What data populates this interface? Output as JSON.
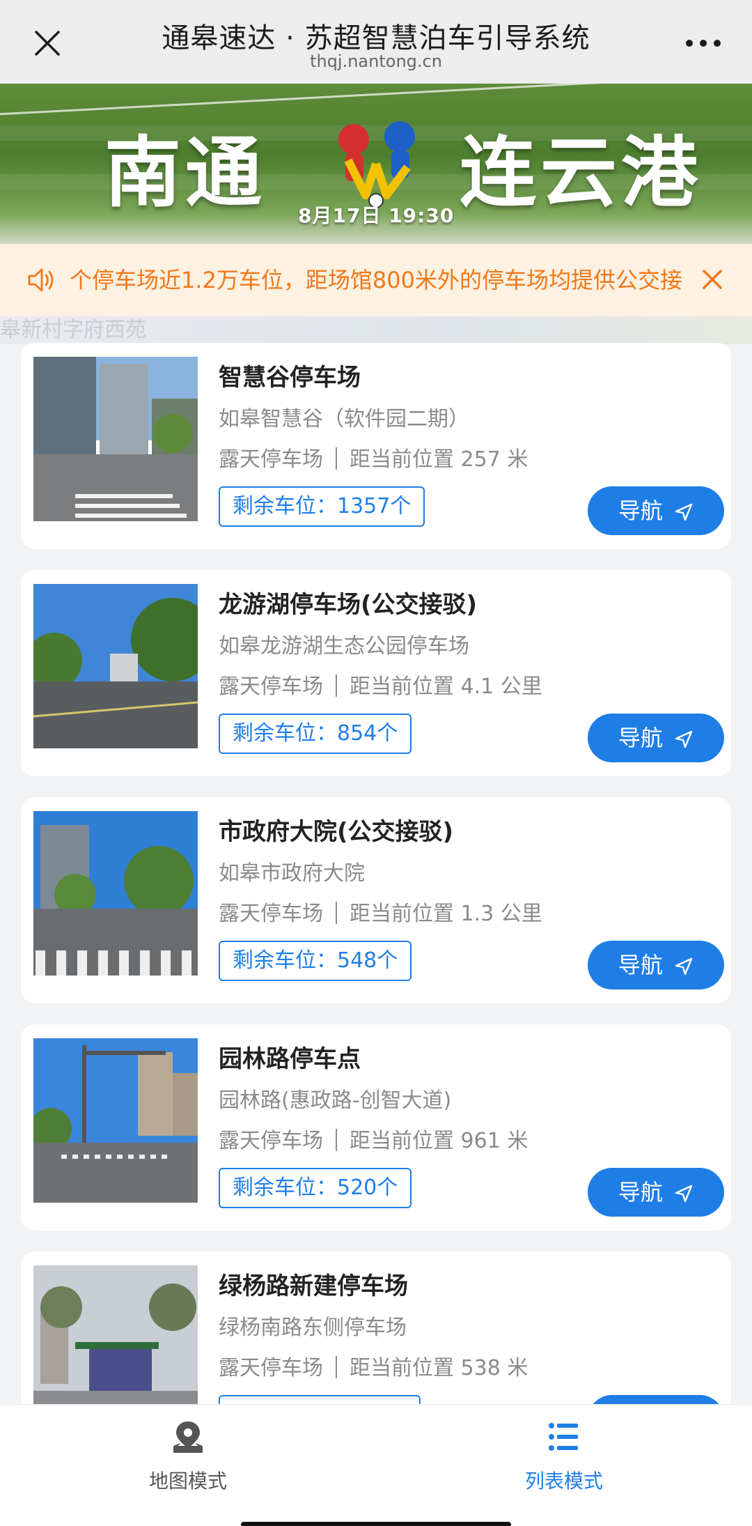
{
  "header": {
    "title": "通皋速达 · 苏超智慧泊车引导系统",
    "url": "thqj.nantong.cn"
  },
  "banner": {
    "team_left": "南通",
    "team_right": "连云港",
    "datetime": "8月17日  19:30"
  },
  "notice": {
    "text": "个停车场近1.2万车位，距场馆800米外的停车场均提供公交接"
  },
  "map_peek_text": "皋新村字府西苑",
  "lots": [
    {
      "name": "智慧谷停车场",
      "address": "如皋智慧谷（软件园二期）",
      "type": "露天停车场",
      "distance": "距当前位置 257 米",
      "spaces": "剩余车位：1357个",
      "nav_label": "导航"
    },
    {
      "name": "龙游湖停车场(公交接驳)",
      "address": "如皋龙游湖生态公园停车场",
      "type": "露天停车场",
      "distance": "距当前位置 4.1 公里",
      "spaces": "剩余车位：854个",
      "nav_label": "导航"
    },
    {
      "name": "市政府大院(公交接驳)",
      "address": "如皋市政府大院",
      "type": "露天停车场",
      "distance": "距当前位置 1.3 公里",
      "spaces": "剩余车位：548个",
      "nav_label": "导航"
    },
    {
      "name": "园林路停车点",
      "address": "园林路(惠政路-创智大道)",
      "type": "露天停车场",
      "distance": "距当前位置 961 米",
      "spaces": "剩余车位：520个",
      "nav_label": "导航"
    },
    {
      "name": "绿杨路新建停车场",
      "address": "绿杨南路东侧停车场",
      "type": "露天停车场",
      "distance": "距当前位置 538 米",
      "spaces": "",
      "nav_label": ""
    }
  ],
  "tabbar": {
    "map_label": "地图模式",
    "list_label": "列表模式"
  },
  "colors": {
    "accent": "#1f7ee6",
    "notice_text": "#f0781a",
    "notice_bg": "#fdf1e1"
  }
}
